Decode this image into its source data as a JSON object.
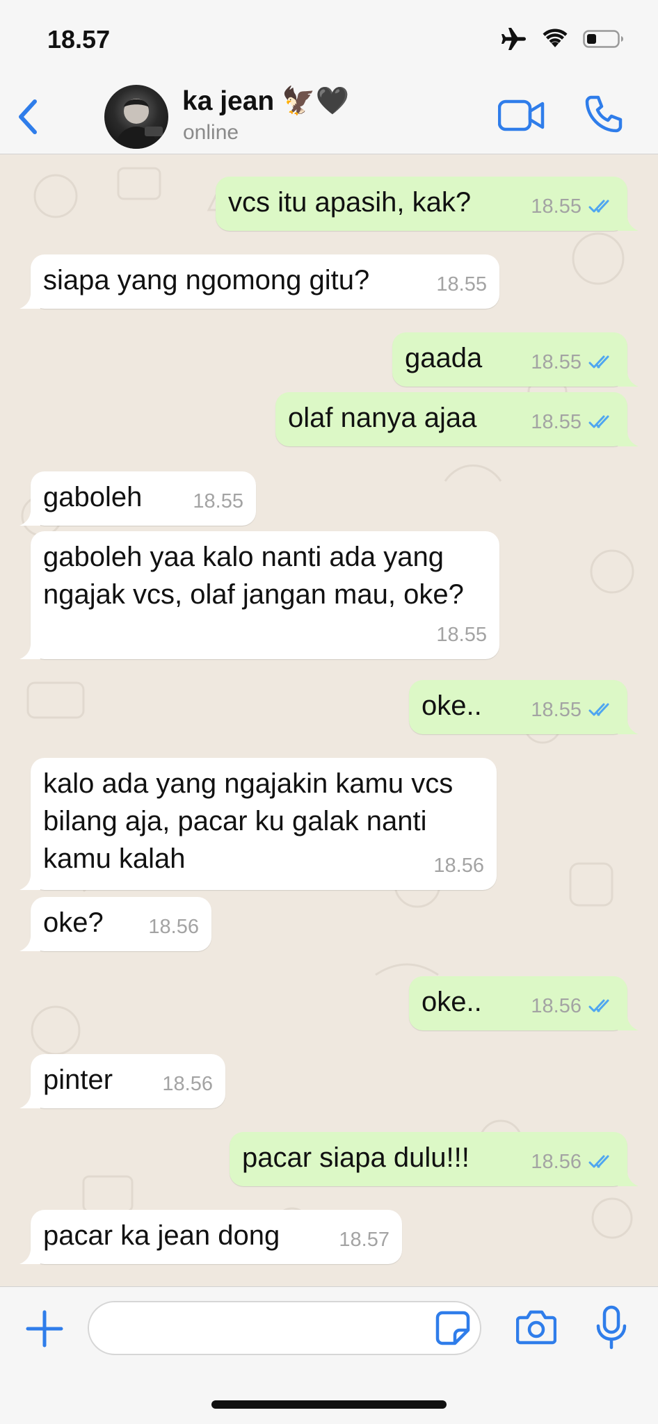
{
  "status_bar": {
    "time": "18.57",
    "icons": [
      "airplane-icon",
      "wifi-icon",
      "battery-icon"
    ]
  },
  "header": {
    "back_icon": "chevron-left-icon",
    "contact_name": "ka jean 🦅🖤",
    "contact_status": "online",
    "video_icon": "video-call-icon",
    "call_icon": "phone-icon"
  },
  "colors": {
    "accent": "#2f7dea",
    "incoming_bubble": "#ffffff",
    "outgoing_bubble": "#dcf8c6",
    "read_ticks": "#4fa6f0",
    "chat_background": "#efe8df"
  },
  "messages": [
    {
      "direction": "out",
      "text": "vcs itu apasih, kak?",
      "time": "18.55",
      "read": true
    },
    {
      "direction": "in",
      "text": "siapa yang ngomong gitu?",
      "time": "18.55"
    },
    {
      "direction": "out",
      "text": "gaada",
      "time": "18.55",
      "read": true
    },
    {
      "direction": "out",
      "text": "olaf nanya ajaa",
      "time": "18.55",
      "read": true
    },
    {
      "direction": "in",
      "text": "gaboleh",
      "time": "18.55"
    },
    {
      "direction": "in",
      "text": "gaboleh yaa kalo nanti ada yang\nngajak vcs, olaf jangan mau, oke?",
      "time": "18.55"
    },
    {
      "direction": "out",
      "text": "oke..",
      "time": "18.55",
      "read": true
    },
    {
      "direction": "in",
      "text": "kalo ada yang ngajakin kamu vcs\nbilang aja, pacar ku galak nanti\nkamu kalah",
      "time": "18.56"
    },
    {
      "direction": "in",
      "text": "oke?",
      "time": "18.56"
    },
    {
      "direction": "out",
      "text": "oke..",
      "time": "18.56",
      "read": true
    },
    {
      "direction": "in",
      "text": "pinter",
      "time": "18.56"
    },
    {
      "direction": "out",
      "text": "pacar siapa dulu!!!",
      "time": "18.56",
      "read": true
    },
    {
      "direction": "in",
      "text": "pacar ka jean dong",
      "time": "18.57"
    }
  ],
  "input_bar": {
    "plus_icon": "plus-icon",
    "message_placeholder": "",
    "sticker_icon": "sticker-icon",
    "camera_icon": "camera-icon",
    "mic_icon": "microphone-icon"
  }
}
